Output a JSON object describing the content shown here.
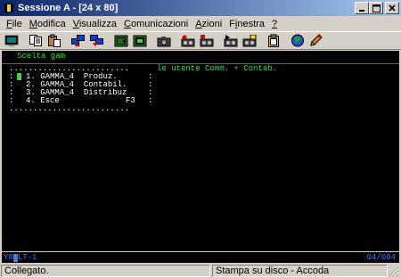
{
  "window": {
    "title": "Sessione A - [24 x 80]",
    "controls": {
      "minimize": "_",
      "maximize": "□",
      "close": "×"
    }
  },
  "menu": {
    "items": [
      {
        "label": "File",
        "accel": "F"
      },
      {
        "label": "Modifica",
        "accel": "M"
      },
      {
        "label": "Visualizza",
        "accel": "V"
      },
      {
        "label": "Comunicazioni",
        "accel": "C"
      },
      {
        "label": "Azioni",
        "accel": "A"
      },
      {
        "label": "Finestra",
        "accel": "i"
      },
      {
        "label": "?",
        "accel": "?"
      }
    ]
  },
  "toolbar": {
    "buttons": [
      {
        "icon": "print-screen-icon"
      },
      {
        "icon": "copy-icon"
      },
      {
        "icon": "paste-icon"
      },
      {
        "icon": "send-file-icon"
      },
      {
        "icon": "receive-file-icon"
      },
      {
        "icon": "display-icon"
      },
      {
        "icon": "session-icon"
      },
      {
        "icon": "camera-icon"
      },
      {
        "icon": "record-macro-icon"
      },
      {
        "icon": "stop-macro-icon"
      },
      {
        "icon": "play-macro-icon"
      },
      {
        "icon": "macro-settings-icon"
      },
      {
        "icon": "clipboard-icon"
      },
      {
        "icon": "globe-icon"
      },
      {
        "icon": "edit-icon"
      }
    ]
  },
  "terminal": {
    "header_left": "Scelta gam",
    "header_right": "le utente Comm. + Contab.",
    "menu_box": {
      "border_top": ".........................",
      "border_bottom": ".........................",
      "options": [
        {
          "num": "1.",
          "name": "GAMMA_4",
          "desc": "Produz."
        },
        {
          "num": "2.",
          "name": "GAMMA_4",
          "desc": "Contabil."
        },
        {
          "num": "3.",
          "name": "GAMMA_4",
          "desc": "Distribuz"
        },
        {
          "num": "4.",
          "name": "Esce",
          "desc": "F3"
        }
      ]
    }
  },
  "oia": {
    "left": "Y8",
    "left_after_cursor": "LT-1",
    "right": "04/004"
  },
  "status": {
    "connection": "Collegato.",
    "print": "Stampa su disco - Accoda"
  }
}
